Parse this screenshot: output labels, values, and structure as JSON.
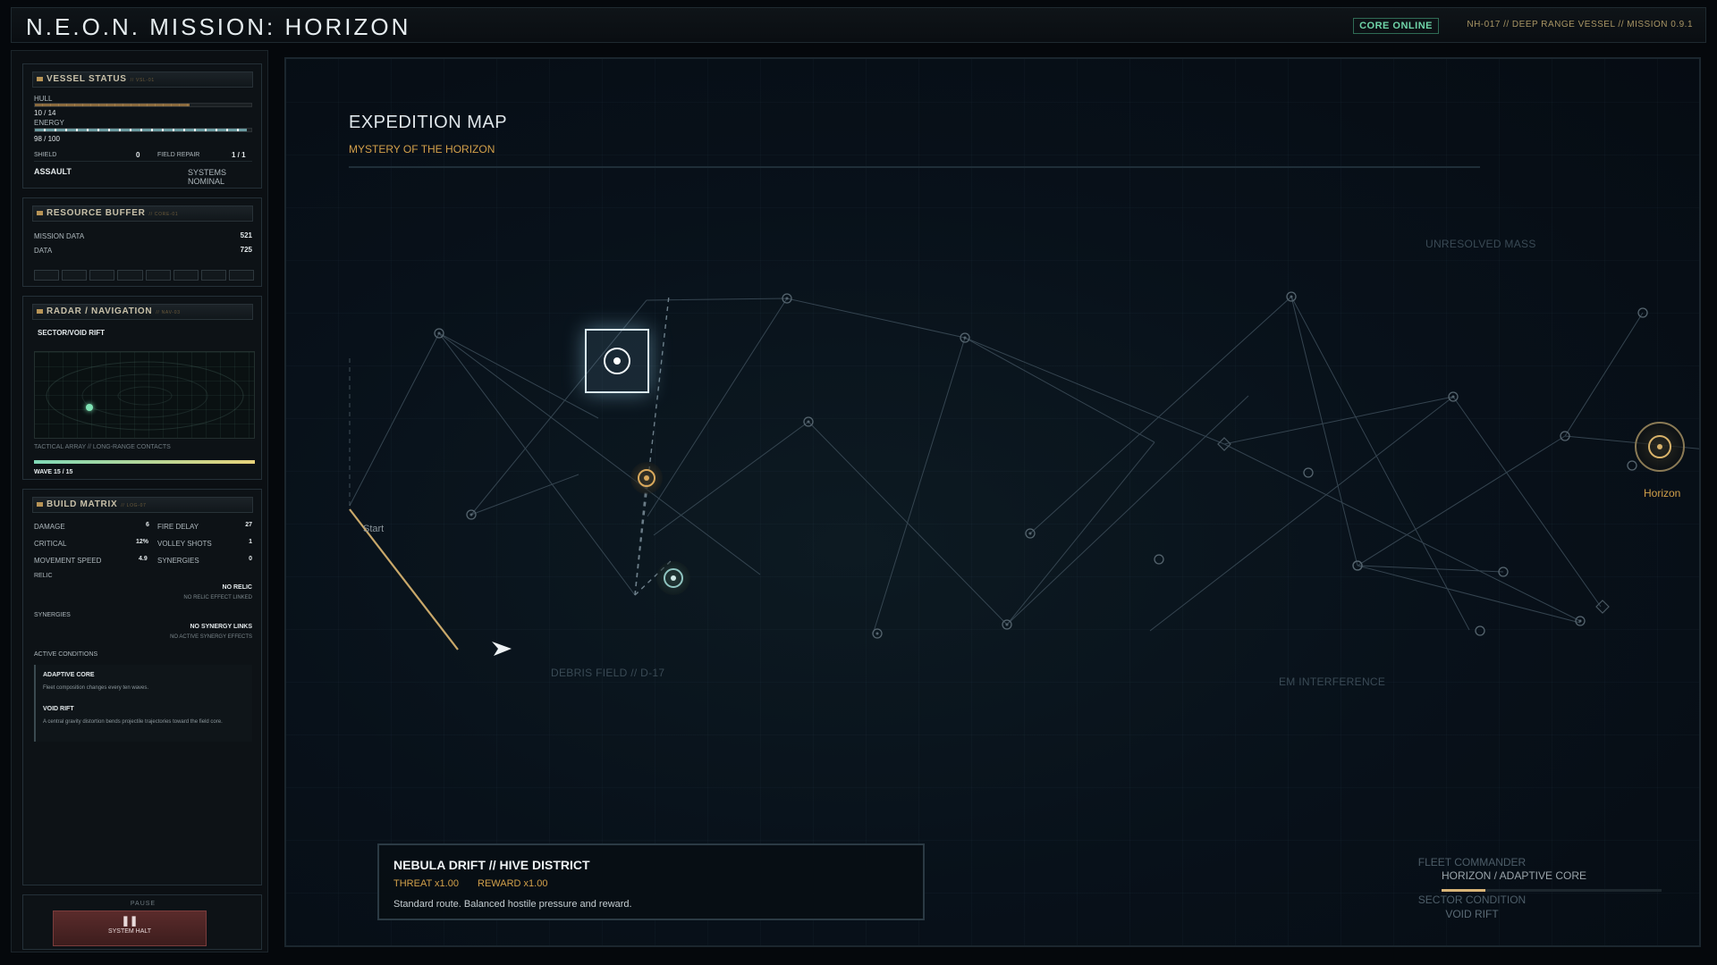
{
  "header": {
    "title": "N.E.O.N. MISSION: HORIZON",
    "status_badge": "CORE ONLINE",
    "meta": "NH-017 // DEEP RANGE VESSEL // MISSION 0.9.1"
  },
  "vessel": {
    "title": "VESSEL STATUS",
    "code": "// VSL-01",
    "hull_label": "HULL",
    "hull_value": "10 / 14",
    "hull_fraction": 0.714,
    "energy_label": "ENERGY",
    "energy_value": "98 / 100",
    "energy_fraction": 0.98,
    "shield_label": "SHIELD",
    "shield_value": "0",
    "repair_label": "FIELD REPAIR",
    "repair_value": "1 / 1",
    "mode": "ASSAULT",
    "systems": "SYSTEMS NOMINAL"
  },
  "resources": {
    "title": "RESOURCE BUFFER",
    "code": "// CORE-01",
    "mission_data_label": "MISSION DATA",
    "mission_data_value": "521",
    "data_label": "DATA",
    "data_value": "725"
  },
  "radar": {
    "title": "RADAR / NAVIGATION",
    "code": "// NAV-03",
    "sector": "SECTOR/VOID RIFT",
    "caption": "TACTICAL ARRAY // LONG-RANGE CONTACTS",
    "wave": "WAVE 15 / 15"
  },
  "build": {
    "title": "BUILD MATRIX",
    "code": "// LOG-07",
    "damage_label": "DAMAGE",
    "damage_value": "6",
    "fire_delay_label": "FIRE DELAY",
    "fire_delay_value": "27",
    "critical_label": "CRITICAL",
    "critical_value": "12%",
    "volley_label": "VOLLEY SHOTS",
    "volley_value": "1",
    "speed_label": "MOVEMENT SPEED",
    "speed_value": "4.9",
    "synergies_label": "SYNERGIES",
    "synergies_value": "0",
    "relic_heading": "RELIC",
    "relic_value": "NO RELIC",
    "relic_note": "NO RELIC EFFECT LINKED",
    "synergy_heading": "SYNERGIES",
    "synergy_value": "NO SYNERGY LINKS",
    "synergy_note": "NO ACTIVE SYNERGY EFFECTS",
    "conditions_heading": "ACTIVE CONDITIONS",
    "cond1_title": "ADAPTIVE CORE",
    "cond1_desc": "Fleet composition changes every ten waves.",
    "cond2_title": "VOID RIFT",
    "cond2_desc": "A central gravity distortion bends projectile trajectories toward the field core."
  },
  "pause": {
    "label": "PAUSE",
    "icon": "pause-icon",
    "button_label": "SYSTEM HALT"
  },
  "map": {
    "title": "EXPEDITION MAP",
    "subtitle": "MYSTERY OF THE HORIZON",
    "start_label": "Start",
    "end_label": "Horizon",
    "zones": [
      "UNRESOLVED MASS",
      "DEBRIS FIELD // D-17",
      "EM INTERFERENCE"
    ],
    "accent_color": "#d2a04a",
    "route_color": "#c9a86a"
  },
  "info": {
    "title": "NEBULA DRIFT  //  HIVE DISTRICT",
    "threat": "THREAT x1.00",
    "reward": "REWARD x1.00",
    "description": "Standard route. Balanced hostile pressure and reward."
  },
  "fleet": {
    "commander_label": "FLEET COMMANDER",
    "commander_value": "HORIZON / ADAPTIVE CORE",
    "progress": 0.2,
    "sector_label": "SECTOR CONDITION",
    "sector_value": "VOID RIFT"
  }
}
